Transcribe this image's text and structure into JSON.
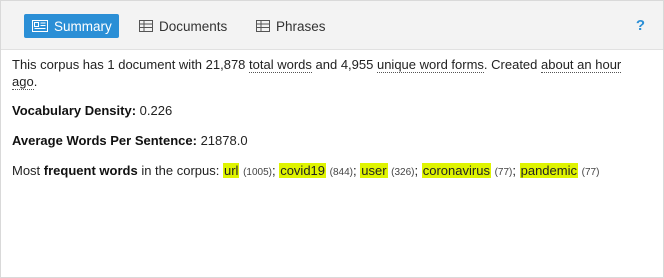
{
  "tabs": {
    "summary": "Summary",
    "documents": "Documents",
    "phrases": "Phrases"
  },
  "help_label": "?",
  "summary": {
    "part1": "This corpus has 1 document with 21,878 ",
    "total_words_link": "total words",
    "part2": " and 4,955 ",
    "unique_forms_link": "unique word forms",
    "part3": ". Created ",
    "created_link": "about an hour",
    "part4_link": "ago",
    "part5": "."
  },
  "vocab": {
    "label": "Vocabulary Density:",
    "value": " 0.226"
  },
  "avg": {
    "label": "Average Words Per Sentence:",
    "value": " 21878.0"
  },
  "frequent": {
    "prefix": "Most ",
    "bold": "frequent words",
    "suffix": " in the corpus: ",
    "terms": [
      {
        "word": "url",
        "count": "(1005)",
        "sep": "; "
      },
      {
        "word": "covid19",
        "count": "(844)",
        "sep": "; "
      },
      {
        "word": "user",
        "count": "(326)",
        "sep": "; "
      },
      {
        "word": "coronavirus",
        "count": "(77)",
        "sep": "; "
      },
      {
        "word": "pandemic",
        "count": "(77)",
        "sep": ""
      }
    ]
  },
  "colors": {
    "accent": "#2b8fd6",
    "highlight": "#dff400"
  },
  "icons": {
    "summary": "summary-icon",
    "documents": "table-icon",
    "phrases": "table-icon",
    "help": "help-icon"
  }
}
